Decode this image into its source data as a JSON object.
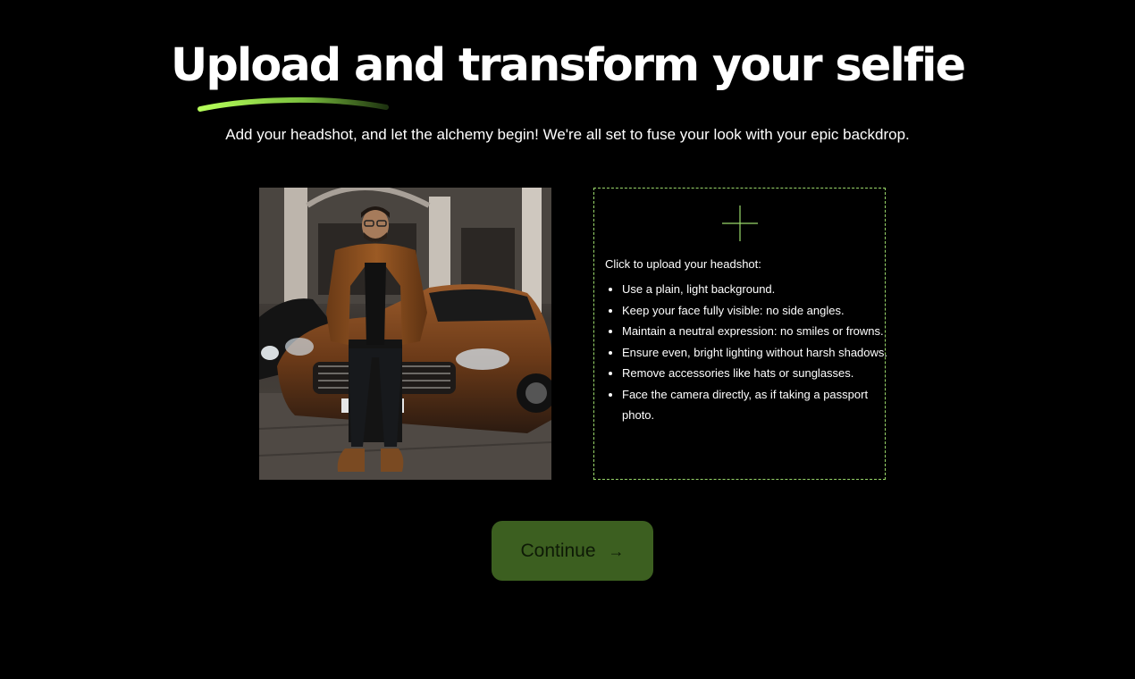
{
  "header": {
    "title": "Upload and transform your selfie",
    "subtitle": "Add your headshot, and let the alchemy begin! We're all set to fuse your look with your epic backdrop."
  },
  "upload": {
    "prompt": "Click to upload your headshot:",
    "tips": [
      "Use a plain, light background.",
      "Keep your face fully visible: no side angles.",
      "Maintain a neutral expression: no smiles or frowns.",
      "Ensure even, bright lighting without harsh shadows.",
      "Remove accessories like hats or sunglasses.",
      "Face the camera directly, as if taking a passport photo."
    ],
    "icon": "plus-icon"
  },
  "actions": {
    "continue_label": "Continue",
    "continue_icon": "arrow-right-icon",
    "arrow_glyph": "→"
  },
  "colors": {
    "background": "#000000",
    "accent": "#9ad86a",
    "button": "#3c5f20"
  }
}
